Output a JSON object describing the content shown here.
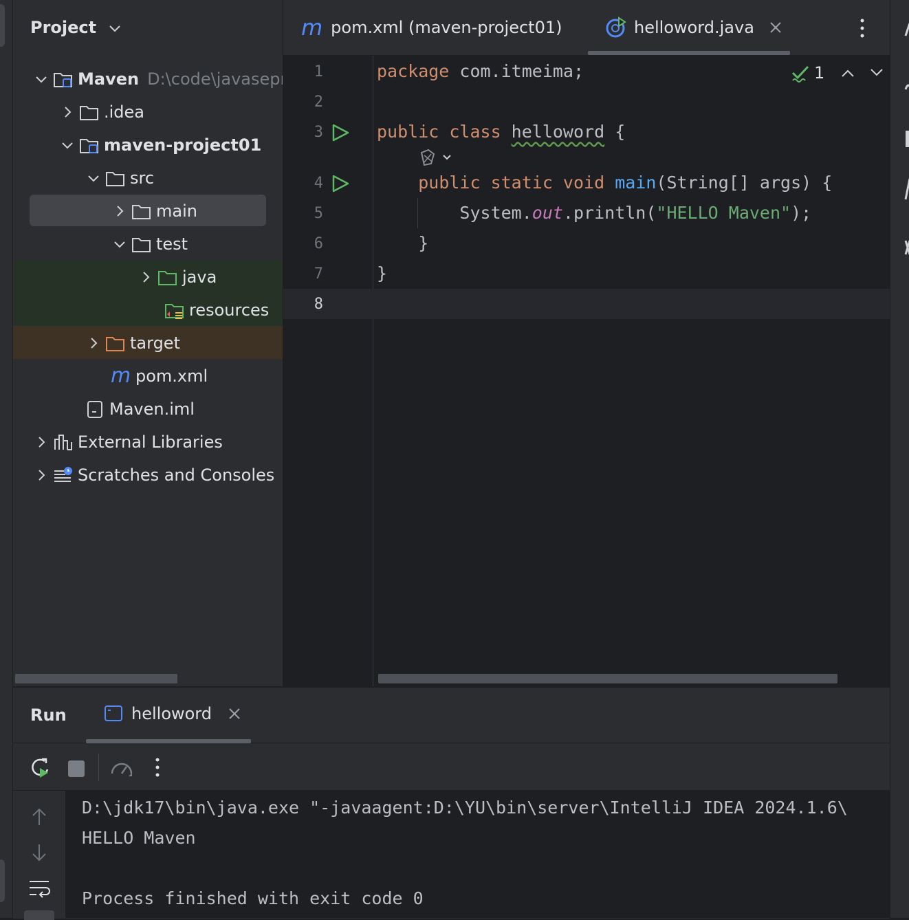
{
  "project_panel": {
    "title": "Project",
    "tree": [
      {
        "label": "Maven",
        "path": "D:\\code\\javasepr",
        "icon": "module-folder-icon"
      },
      {
        "label": ".idea",
        "icon": "folder-icon"
      },
      {
        "label": "maven-project01",
        "icon": "module-folder-icon"
      },
      {
        "label": "src",
        "icon": "folder-icon"
      },
      {
        "label": "main",
        "icon": "folder-icon"
      },
      {
        "label": "test",
        "icon": "folder-icon"
      },
      {
        "label": "java",
        "icon": "test-source-folder-icon"
      },
      {
        "label": "resources",
        "icon": "test-resources-folder-icon"
      },
      {
        "label": "target",
        "icon": "excluded-folder-icon"
      },
      {
        "label": "pom.xml",
        "icon": "maven-icon"
      },
      {
        "label": "Maven.iml",
        "icon": "iml-file-icon"
      },
      {
        "label": "External Libraries",
        "icon": "library-icon"
      },
      {
        "label": "Scratches and Consoles",
        "icon": "scratches-icon"
      }
    ]
  },
  "editor": {
    "tabs": [
      {
        "label": "pom.xml (maven-project01)",
        "icon": "maven-icon",
        "active": false
      },
      {
        "label": "helloword.java",
        "icon": "java-class-run-icon",
        "active": true
      }
    ],
    "inspection_count": "1",
    "line_numbers": [
      "1",
      "2",
      "3",
      "4",
      "5",
      "6",
      "7",
      "8"
    ],
    "code": {
      "l1_kw": "package",
      "l1_rest": " com.itmeima;",
      "l3_kw": "public class ",
      "l3_name": "helloword",
      "l3_rest": " {",
      "l4_kw": "public static void ",
      "l4_fn": "main",
      "l4_rest": "(String[] args) {",
      "l5_a": "System.",
      "l5_out": "out",
      "l5_b": ".println(",
      "l5_str": "\"HELLO Maven\"",
      "l5_c": ");",
      "l6": "}",
      "l7": "}"
    }
  },
  "run_panel": {
    "title": "Run",
    "tab_label": "helloword",
    "console": [
      "D:\\jdk17\\bin\\java.exe \"-javaagent:D:\\YU\\bin\\server\\IntelliJ IDEA 2024.1.6\\",
      "HELLO Maven",
      "",
      "Process finished with exit code 0"
    ]
  },
  "colors": {
    "background": "#1e1f22",
    "panel": "#2b2d30",
    "keyword": "#cf8e6d",
    "function": "#56a8f5",
    "string": "#6aab73",
    "static_field": "#c77dbb",
    "run_green": "#5fb865",
    "accent_blue": "#548af7"
  }
}
